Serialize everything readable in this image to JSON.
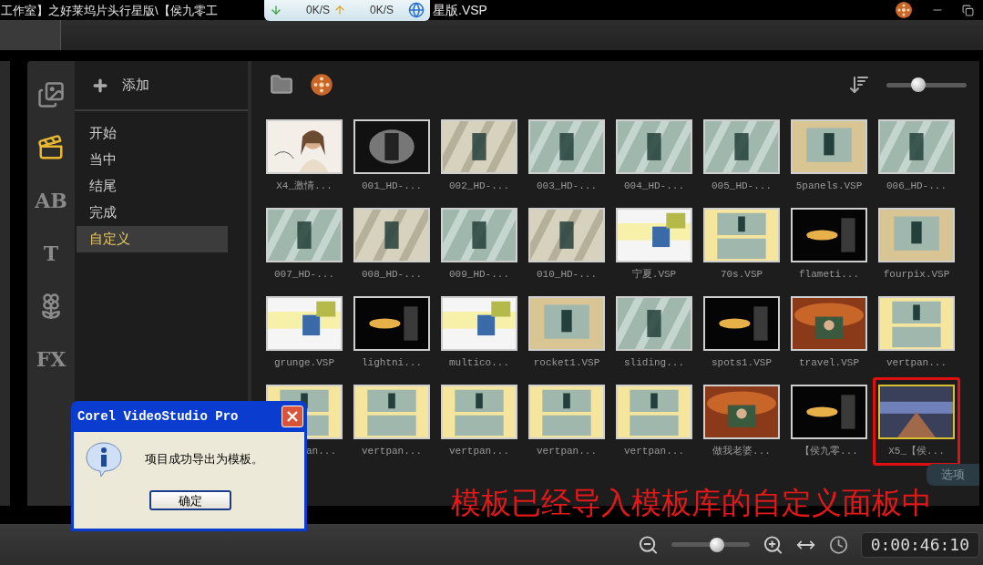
{
  "title_bar": {
    "title_left": "工作室】之好莱坞片头行星版\\【侯九零工",
    "title_right": "星版.VSP"
  },
  "speed_widget": {
    "download": "0K/S",
    "upload": "0K/S"
  },
  "library": {
    "add_button": "添加",
    "rail": [
      {
        "kind": "media",
        "selected": false
      },
      {
        "kind": "project",
        "selected": true
      },
      {
        "kind": "glyph",
        "text": "AB",
        "selected": false
      },
      {
        "kind": "glyph",
        "text": "T",
        "selected": false
      },
      {
        "kind": "graphic",
        "selected": false
      },
      {
        "kind": "glyph",
        "text": "FX",
        "selected": false
      }
    ],
    "categories": [
      {
        "label": "开始",
        "selected": false
      },
      {
        "label": "当中",
        "selected": false
      },
      {
        "label": "结尾",
        "selected": false
      },
      {
        "label": "完成",
        "selected": false
      },
      {
        "label": "自定义",
        "selected": true
      }
    ],
    "size_slider": {
      "level": 0.4
    },
    "thumbnails": [
      {
        "label": "X4_激情...",
        "selected": false,
        "circled": false
      },
      {
        "label": "001_HD-...",
        "selected": false,
        "circled": false
      },
      {
        "label": "002_HD-...",
        "selected": false,
        "circled": false
      },
      {
        "label": "003_HD-...",
        "selected": false,
        "circled": false
      },
      {
        "label": "004_HD-...",
        "selected": false,
        "circled": false
      },
      {
        "label": "005_HD-...",
        "selected": false,
        "circled": false
      },
      {
        "label": "5panels.VSP",
        "selected": false,
        "circled": false
      },
      {
        "label": "006_HD-...",
        "selected": false,
        "circled": false
      },
      {
        "label": "007_HD-...",
        "selected": false,
        "circled": false
      },
      {
        "label": "008_HD-...",
        "selected": false,
        "circled": false
      },
      {
        "label": "009_HD-...",
        "selected": false,
        "circled": false
      },
      {
        "label": "010_HD-...",
        "selected": false,
        "circled": false
      },
      {
        "label": "宁夏.VSP",
        "selected": false,
        "circled": false
      },
      {
        "label": "70s.VSP",
        "selected": false,
        "circled": false
      },
      {
        "label": "flameti...",
        "selected": false,
        "circled": false
      },
      {
        "label": "fourpix.VSP",
        "selected": false,
        "circled": false
      },
      {
        "label": "grunge.VSP",
        "selected": false,
        "circled": false
      },
      {
        "label": "lightni...",
        "selected": false,
        "circled": false
      },
      {
        "label": "multico...",
        "selected": false,
        "circled": false
      },
      {
        "label": "rocket1.VSP",
        "selected": false,
        "circled": false
      },
      {
        "label": "sliding...",
        "selected": false,
        "circled": false
      },
      {
        "label": "spots1.VSP",
        "selected": false,
        "circled": false
      },
      {
        "label": "travel.VSP",
        "selected": false,
        "circled": false
      },
      {
        "label": "vertpan...",
        "selected": false,
        "circled": false
      },
      {
        "label": "an...",
        "selected": false,
        "circled": false
      },
      {
        "label": "vertpan...",
        "selected": false,
        "circled": false
      },
      {
        "label": "vertpan...",
        "selected": false,
        "circled": false
      },
      {
        "label": "vertpan...",
        "selected": false,
        "circled": false
      },
      {
        "label": "vertpan...",
        "selected": false,
        "circled": false
      },
      {
        "label": "做我老婆...",
        "selected": false,
        "circled": false
      },
      {
        "label": "【侯九零...",
        "selected": false,
        "circled": false
      },
      {
        "label": "X5_【侯...",
        "selected": true,
        "circled": true
      }
    ],
    "options_button": "选项"
  },
  "dialog": {
    "title": "Corel VideoStudio Pro",
    "message": "项目成功导出为模板。",
    "ok_button": "确定"
  },
  "annotation": {
    "text": "模板已经导入模板库的自定义面板中"
  },
  "timeline_bar": {
    "zoom_slider": {
      "level": 0.58
    },
    "timecode": "0:00:46:10"
  }
}
